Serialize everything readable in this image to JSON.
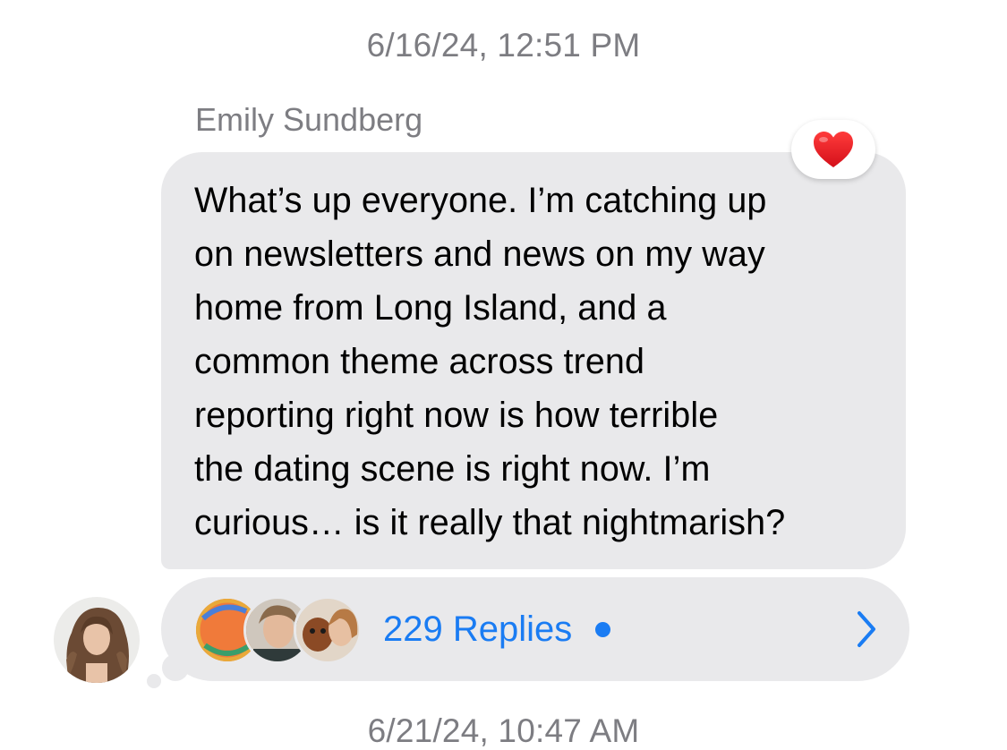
{
  "conversation": {
    "timestamp_top": "6/16/24, 12:51 PM",
    "timestamp_bottom": "6/21/24, 10:47 AM"
  },
  "message": {
    "sender": "Emily Sundberg",
    "text": "What’s up everyone. I’m catching up\non newsletters and news on my way\nhome from Long Island, and a\ncommon theme across trend\nreporting right now is how terrible\nthe dating scene is right now. I’m\ncurious… is it really that nightmarish?",
    "reaction": "heart",
    "bubble_color": "#e9e9eb"
  },
  "thread": {
    "replies_label": "229 Replies",
    "unread": true,
    "accent_color": "#1a7cf3",
    "participant_avatars": [
      "participant-avatar-1",
      "participant-avatar-2",
      "participant-avatar-3"
    ],
    "chevron_icon": "chevron-right-icon"
  },
  "sender_avatar": "sender-avatar"
}
